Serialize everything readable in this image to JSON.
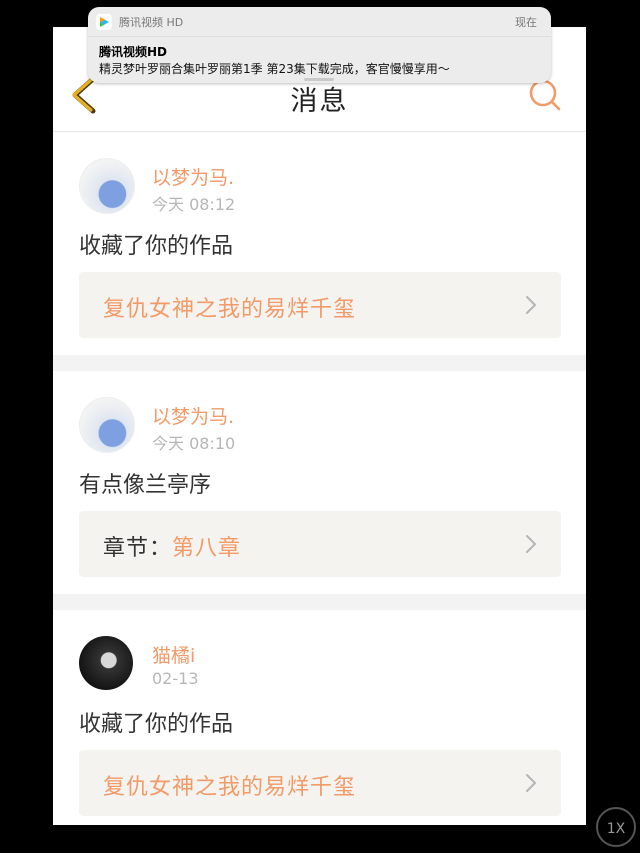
{
  "notification": {
    "app_name": "腾讯视频 HD",
    "time": "现在",
    "title": "腾讯视频HD",
    "body": "精灵梦叶罗丽合集叶罗丽第1季 第23集下载完成，客官慢慢享用～",
    "app_icon": "tencent-video-logo"
  },
  "header": {
    "title": "消息",
    "back_icon": "chevron-left-icon",
    "search_icon": "search-icon"
  },
  "messages": [
    {
      "username": "以梦为马.",
      "time": "今天 08:12",
      "content": "收藏了你的作品",
      "link_prefix": "",
      "link_text": "复仇女神之我的易烊千玺"
    },
    {
      "username": "以梦为马.",
      "time": "今天 08:10",
      "content": "有点像兰亭序",
      "link_prefix": "章节：",
      "link_text": "第八章"
    },
    {
      "username": "猫橘i",
      "time": "02-13",
      "content": "收藏了你的作品",
      "link_prefix": "",
      "link_text": "复仇女神之我的易烊千玺"
    }
  ],
  "playback": {
    "speed_label": "1X"
  },
  "colors": {
    "accent": "#f29a68",
    "link_bg": "#f4f3ef",
    "separator": "#f3f3f3",
    "back_icon": "#e6b020"
  }
}
